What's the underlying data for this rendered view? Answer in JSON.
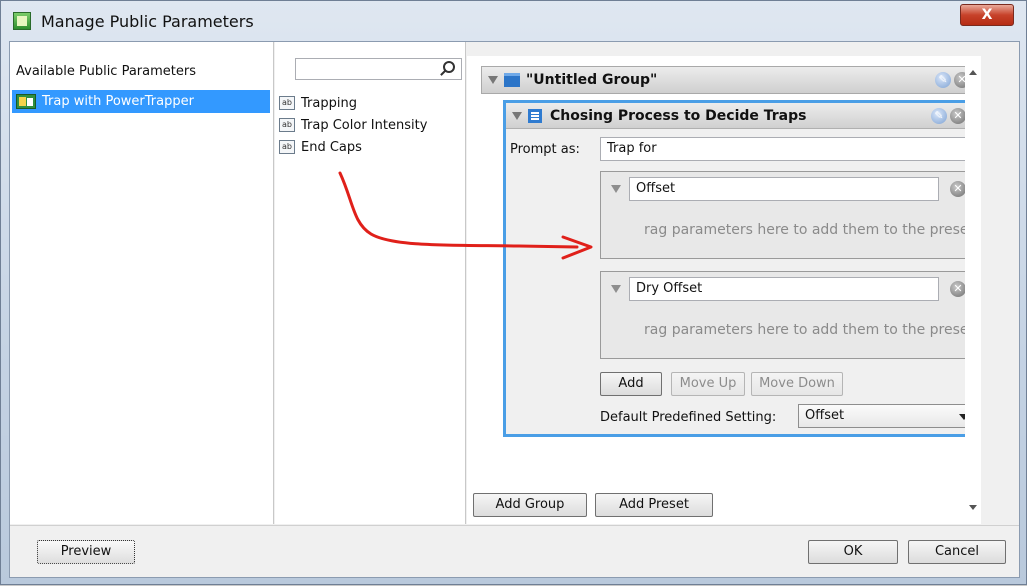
{
  "window": {
    "title": "Manage Public Parameters",
    "close_label": "X"
  },
  "left": {
    "header": "Available Public Parameters",
    "selected_item": "Trap with PowerTrapper"
  },
  "middle": {
    "search_placeholder": "",
    "items": [
      "Trapping",
      "Trap Color Intensity",
      "End Caps"
    ],
    "icon_text": "ab"
  },
  "group": {
    "title": "\"Untitled Group\""
  },
  "process": {
    "title": "Chosing Process to Decide Traps",
    "prompt_label": "Prompt as:",
    "prompt_value": "Trap for",
    "presets": [
      {
        "name": "Offset",
        "hint": "rag parameters here to add them to the preset"
      },
      {
        "name": "Dry Offset",
        "hint": "rag parameters here to add them to the preset"
      }
    ],
    "buttons": {
      "add": "Add",
      "move_up": "Move Up",
      "move_down": "Move Down"
    },
    "default_label": "Default Predefined Setting:",
    "default_value": "Offset"
  },
  "actions": {
    "add_group": "Add Group",
    "add_preset": "Add Preset"
  },
  "footer": {
    "preview": "Preview",
    "ok": "OK",
    "cancel": "Cancel"
  },
  "colors": {
    "selection": "#3399ff",
    "arrow": "#e0201a",
    "process_border": "#4a9ee6"
  }
}
